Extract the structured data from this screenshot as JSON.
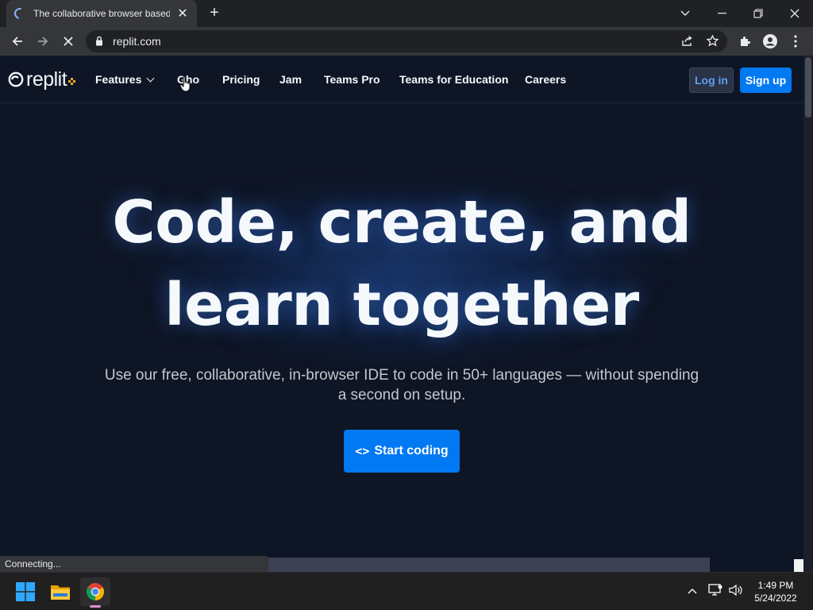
{
  "browser": {
    "tab_title": "The collaborative browser based",
    "url": "replit.com",
    "status_text": "Connecting..."
  },
  "site": {
    "logo_text": "replit",
    "nav": [
      {
        "label": "Features"
      },
      {
        "label": "Ghost Writer"
      },
      {
        "label": "Pricing"
      },
      {
        "label": "Jam"
      },
      {
        "label": "Teams Pro"
      },
      {
        "label": "Teams for Education"
      },
      {
        "label": "Careers"
      }
    ],
    "login_label": "Log in",
    "signup_label": "Sign up",
    "headline_line1": "Code, create, and",
    "headline_line2": "learn together",
    "subtitle": "Use our free, collaborative, in-browser IDE to code in 50+ languages — without spending a second on setup.",
    "cta_label": "Start coding",
    "cta_icon": "<>"
  },
  "taskbar": {
    "time": "1:49 PM",
    "date": "5/24/2022"
  },
  "colors": {
    "accent": "#0079f2",
    "background": "#0e1525",
    "logo_dots": "#f5a623"
  }
}
